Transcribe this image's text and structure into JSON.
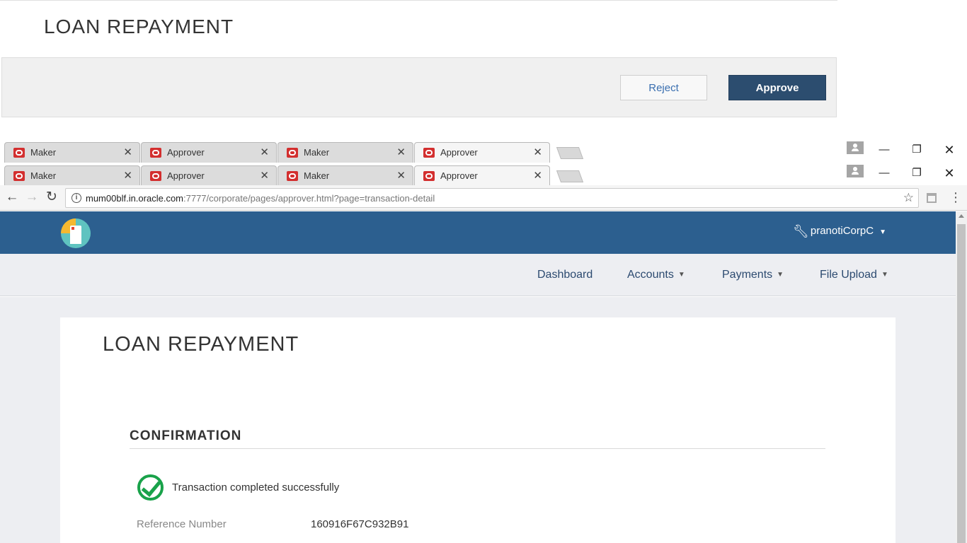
{
  "stale_fragment": {
    "title": "LOAN REPAYMENT",
    "reject_label": "Reject",
    "approve_label": "Approve"
  },
  "browser": {
    "tabs": [
      {
        "label": "Maker",
        "close": "✕"
      },
      {
        "label": "Approver",
        "close": "✕"
      },
      {
        "label": "Maker",
        "close": "✕"
      },
      {
        "label": "Approver",
        "close": "✕",
        "active": true
      }
    ],
    "url_host": "mum00blf.in.oracle.com",
    "url_rest": ":7777/corporate/pages/approver.html?page=transaction-detail",
    "icons": {
      "back": "←",
      "forward": "→",
      "reload": "↻",
      "info": "i",
      "star": "☆",
      "menu": "⋮",
      "minimize": "—",
      "maximize": "❐",
      "close": "✕"
    }
  },
  "app": {
    "user_name": "pranotiCorpC",
    "nav": {
      "dashboard": "Dashboard",
      "accounts": "Accounts",
      "payments": "Payments",
      "file_upload": "File Upload"
    },
    "page_title": "LOAN REPAYMENT",
    "section_heading": "CONFIRMATION",
    "success_message": "Transaction completed successfully",
    "reference_label": "Reference Number",
    "reference_value": "160916F67C932B91"
  },
  "colors": {
    "header_bg": "#2c5f8f",
    "approve_bg": "#2c4d6f",
    "success_green": "#19a24a",
    "nav_text": "#2c4a70"
  }
}
